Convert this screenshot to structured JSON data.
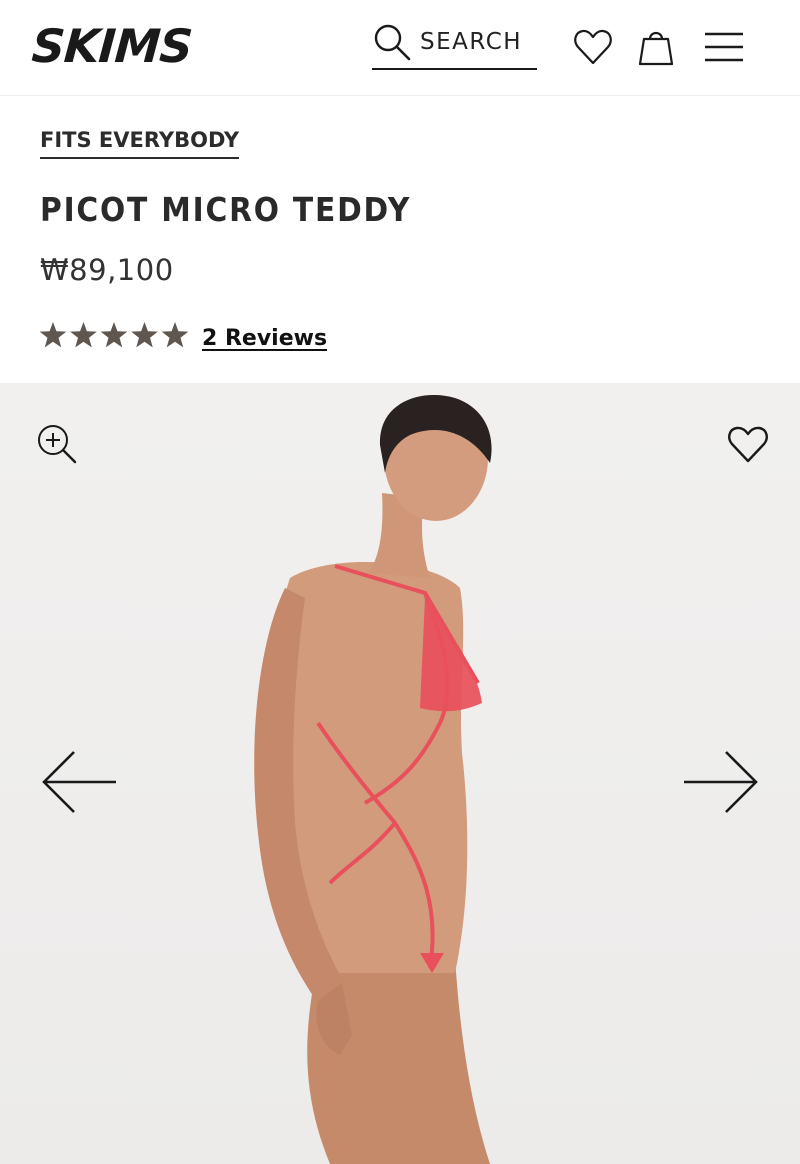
{
  "header": {
    "logo": "SKIMS",
    "search_label": "SEARCH",
    "icons": [
      "search-icon",
      "heart-icon",
      "shopping-bag-icon",
      "hamburger-menu-icon"
    ]
  },
  "product": {
    "badge": "FITS EVERYBODY",
    "title": "PICOT MICRO TEDDY",
    "price": "₩89,100",
    "rating": 5,
    "rating_max": 5,
    "reviews_label": "2 Reviews"
  },
  "gallery": {
    "icons": [
      "zoom-in-icon",
      "heart-icon",
      "arrow-left-icon",
      "arrow-right-icon"
    ]
  },
  "colors": {
    "text": "#222222",
    "star": "#5f574f",
    "product_accent": "#e8505b",
    "photo_background": "#efeeed"
  }
}
